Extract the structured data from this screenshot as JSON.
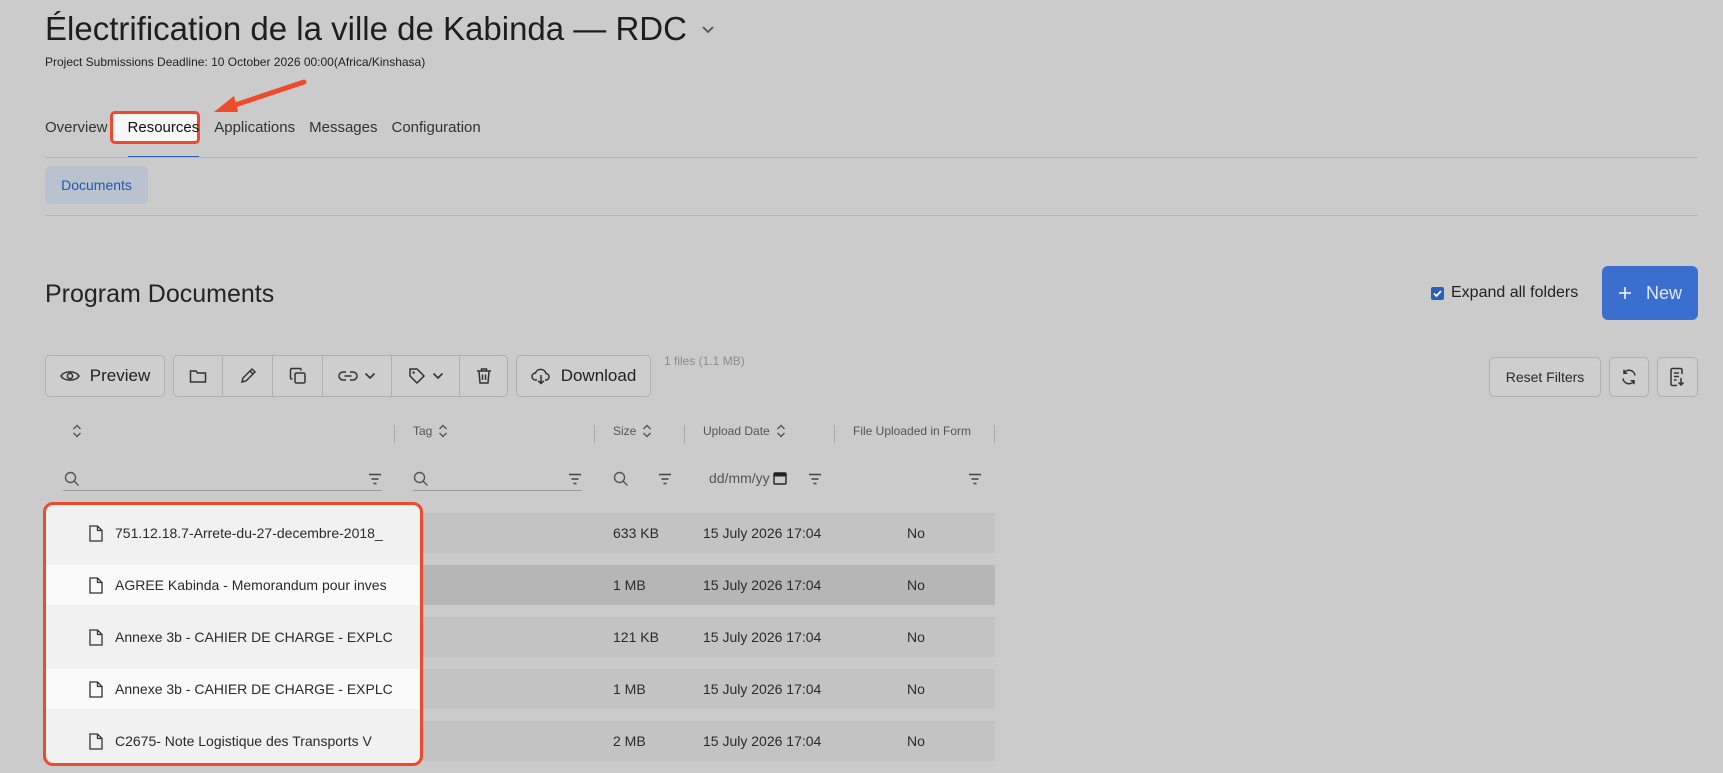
{
  "header": {
    "title": "Électrification de la ville de Kabinda — RDC",
    "deadline_label": "Project Submissions Deadline:",
    "deadline_value": "10 October 2026 00:00(Africa/Kinshasa)"
  },
  "tabs": [
    {
      "label": "Overview"
    },
    {
      "label": "Resources",
      "active": true
    },
    {
      "label": "Applications"
    },
    {
      "label": "Messages"
    },
    {
      "label": "Configuration"
    }
  ],
  "subtabs": {
    "documents": "Documents"
  },
  "section": {
    "title": "Program Documents",
    "expand_label": "Expand all folders",
    "expand_checked": true,
    "new_label": "New"
  },
  "toolbar": {
    "preview": "Preview",
    "download": "Download",
    "files_count": "1 files (1.1 MB)",
    "reset_filters": "Reset Filters"
  },
  "table": {
    "columns": {
      "tag": "Tag",
      "size": "Size",
      "upload_date": "Upload Date",
      "uploaded_in_form": "File Uploaded in Form"
    },
    "date_placeholder": "dd/mm/yy",
    "rows": [
      {
        "name": "751.12.18.7-Arrete-du-27-decembre-2018_",
        "size": "633 KB",
        "date": "15 July 2026 17:04",
        "in_form": "No"
      },
      {
        "name": "AGREE Kabinda - Memorandum pour inves",
        "size": "1 MB",
        "date": "15 July 2026 17:04",
        "in_form": "No"
      },
      {
        "name": "Annexe 3b - CAHIER DE CHARGE - EXPLC",
        "size": "121 KB",
        "date": "15 July 2026 17:04",
        "in_form": "No"
      },
      {
        "name": "Annexe 3b - CAHIER DE CHARGE - EXPLC",
        "size": "1 MB",
        "date": "15 July 2026 17:04",
        "in_form": "No"
      },
      {
        "name": "C2675- Note Logistique des Transports V",
        "size": "2 MB",
        "date": "15 July 2026 17:04",
        "in_form": "No"
      }
    ]
  },
  "colors": {
    "accent": "#3b6fcf",
    "highlight": "#ef4a2b",
    "background": "#cbcbcb"
  }
}
